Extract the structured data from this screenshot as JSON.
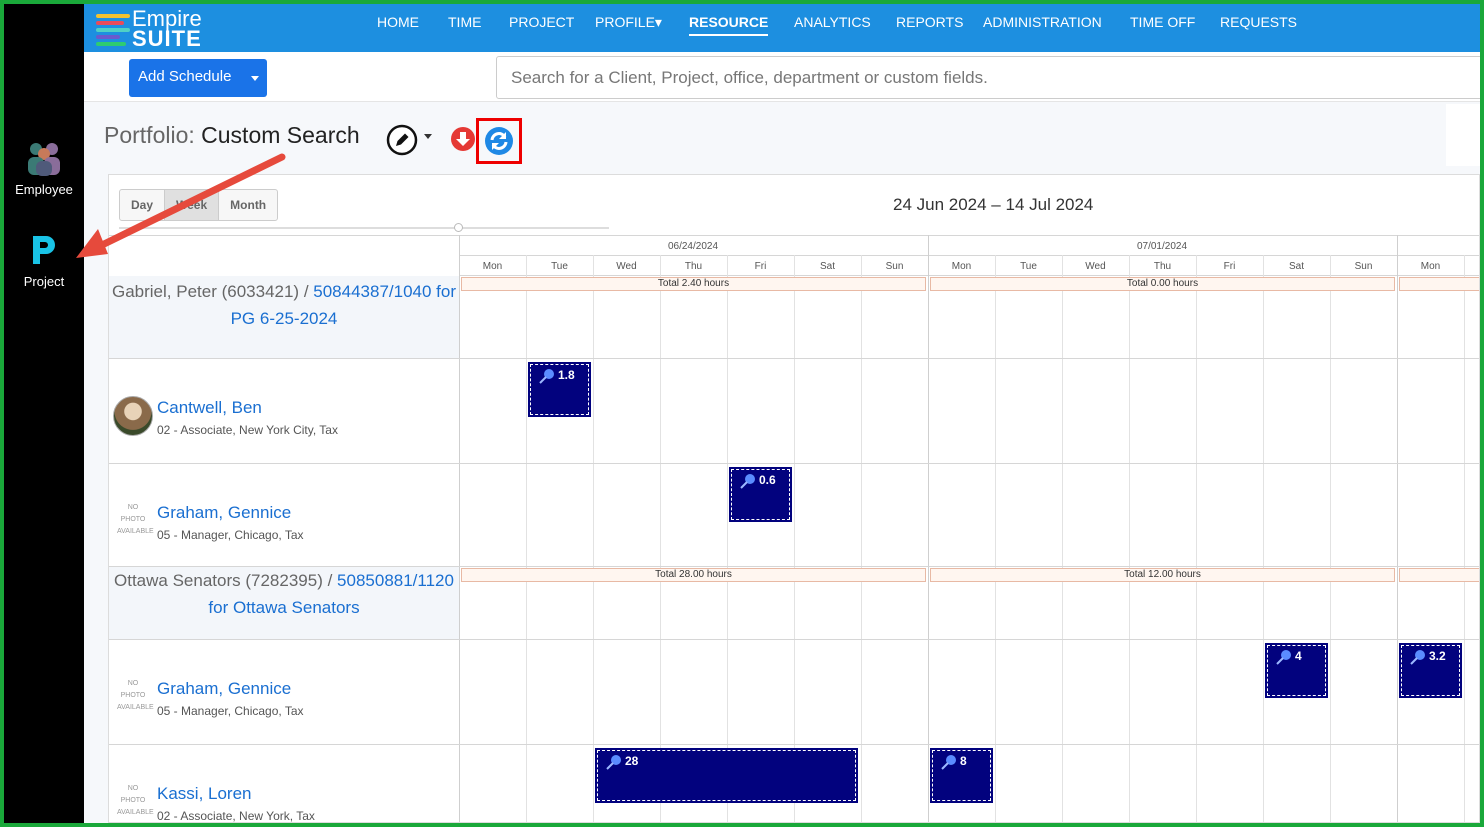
{
  "rail": {
    "items": [
      {
        "label": "Employee",
        "icon": "people-icon"
      },
      {
        "label": "Project",
        "icon": "project-p-icon"
      }
    ]
  },
  "logo": {
    "line1": "Empire",
    "line2": "SUITE"
  },
  "nav": {
    "items": [
      "HOME",
      "TIME",
      "PROJECT",
      "PROFILE▾",
      "RESOURCE",
      "ANALYTICS",
      "REPORTS",
      "ADMINISTRATION",
      "TIME OFF",
      "REQUESTS"
    ],
    "active": "RESOURCE"
  },
  "toolbar": {
    "add_label": "Add Schedule",
    "search_placeholder": "Search for a Client, Project, office, department or custom fields."
  },
  "portfolio": {
    "label": "Portfolio:",
    "value": "Custom Search"
  },
  "calendar": {
    "views": [
      "Day",
      "Week",
      "Month"
    ],
    "selected_view": "Week",
    "range": "24 Jun 2024 – 14 Jul 2024",
    "weeks": [
      "06/24/2024",
      "07/01/2024"
    ],
    "days": [
      "Mon",
      "Tue",
      "Wed",
      "Thu",
      "Fri",
      "Sat",
      "Sun",
      "Mon",
      "Tue",
      "Wed",
      "Thu",
      "Fri",
      "Sat",
      "Sun",
      "Mon"
    ]
  },
  "groups": [
    {
      "client": "Gabriel, Peter (6033421) /",
      "project": "50844387/1040 for PG 6-25-2024",
      "totals": [
        "Total 2.40 hours",
        "Total 0.00 hours"
      ],
      "resources": [
        {
          "name": "Cantwell, Ben",
          "detail": "02 - Associate, New York City, Tax",
          "photo": true,
          "blocks": [
            {
              "value": "1.8"
            }
          ]
        },
        {
          "name": "Graham, Gennice",
          "detail": "05 - Manager, Chicago, Tax",
          "photo": false,
          "blocks": [
            {
              "value": "0.6"
            }
          ]
        }
      ]
    },
    {
      "client": "Ottawa Senators (7282395) /",
      "project": "50850881/1120 for Ottawa Senators",
      "totals": [
        "Total 28.00 hours",
        "Total 12.00 hours"
      ],
      "resources": [
        {
          "name": "Graham, Gennice",
          "detail": "05 - Manager, Chicago, Tax",
          "photo": false,
          "blocks": [
            {
              "value": "4"
            },
            {
              "value": "3.2"
            }
          ]
        },
        {
          "name": "Kassi, Loren",
          "detail": "02 - Associate, New York, Tax",
          "photo": false,
          "blocks": [
            {
              "value": "28"
            },
            {
              "value": "8"
            }
          ]
        }
      ]
    }
  ],
  "no_photo_text": "NO PHOTO AVAILABLE",
  "colors": {
    "nav": "#1d8fe0",
    "block": "#02027e",
    "highlight": "#e00000",
    "frame": "#1aa83a"
  }
}
